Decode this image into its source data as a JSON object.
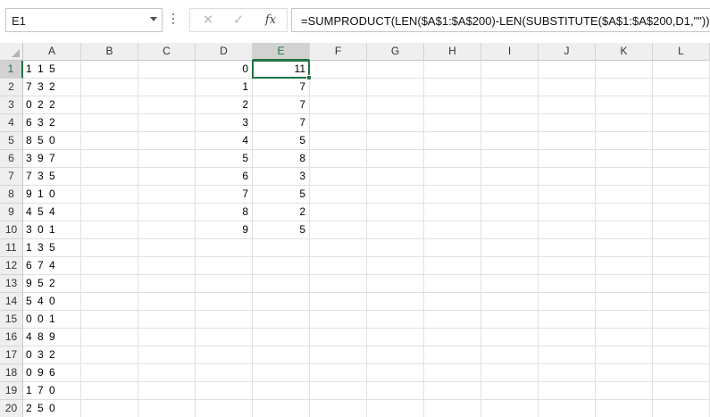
{
  "formula_bar": {
    "name_box": "E1",
    "cancel_icon": "✕",
    "enter_icon": "✓",
    "fx_label": "fx",
    "formula": "=SUMPRODUCT(LEN($A$1:$A$200)-LEN(SUBSTITUTE($A$1:$A$200,D1,\"\")))"
  },
  "sheet": {
    "columns": [
      "A",
      "B",
      "C",
      "D",
      "E",
      "F",
      "G",
      "H",
      "I",
      "J",
      "K",
      "L"
    ],
    "rows": [
      "1",
      "2",
      "3",
      "4",
      "5",
      "6",
      "7",
      "8",
      "9",
      "10",
      "11",
      "12",
      "13",
      "14",
      "15",
      "16",
      "17",
      "18",
      "19",
      "20"
    ],
    "selected_column": "E",
    "selected_row": "1",
    "active_cell": "E1",
    "col_a": [
      "1 1 5",
      "7 3 2",
      "0 2 2",
      "6 3 2",
      "8 5 0",
      "3 9 7",
      "7 3 5",
      "9 1 0",
      "4 5 4",
      "3 0 1",
      "1 3 5",
      "6 7 4",
      "9 5 2",
      "5 4 0",
      "0 0 1",
      "4 8 9",
      "0 3 2",
      "0 9 6",
      "1 7 0",
      "2 5 0"
    ],
    "col_d": [
      "0",
      "1",
      "2",
      "3",
      "4",
      "5",
      "6",
      "7",
      "8",
      "9"
    ],
    "col_e": [
      "11",
      "7",
      "7",
      "7",
      "5",
      "8",
      "3",
      "5",
      "2",
      "5"
    ]
  }
}
